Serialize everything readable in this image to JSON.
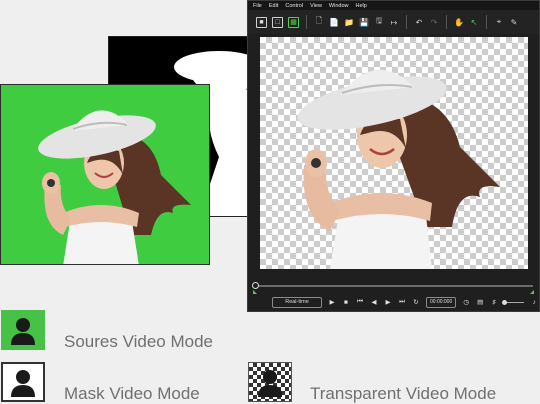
{
  "menu": [
    "File",
    "Edit",
    "Control",
    "View",
    "Window",
    "Help"
  ],
  "toolbar": {
    "mode_buttons": [
      {
        "icon": "source-mode-icon",
        "active": false
      },
      {
        "icon": "mask-mode-icon",
        "active": false
      },
      {
        "icon": "transparent-mode-icon",
        "active": true
      }
    ],
    "file_icons": [
      "new-file-icon",
      "open-file-icon",
      "open-folder-icon",
      "save-icon",
      "save-as-icon",
      "export-icon"
    ],
    "edit_icons": [
      "undo-icon",
      "redo-icon"
    ],
    "tool_icons": [
      "hand-icon",
      "pointer-icon",
      "crop-icon",
      "paint-icon"
    ]
  },
  "controls": {
    "speed_label": "Real-time",
    "timecode": "00:00:000"
  },
  "legend": {
    "source": "Soures Video Mode",
    "mask": "Mask Video Mode",
    "transparent": "Transparent Video Mode"
  },
  "colors": {
    "green_screen": "#40cc40",
    "accent": "#4fd04f",
    "window_bg": "#1f1f1f"
  }
}
